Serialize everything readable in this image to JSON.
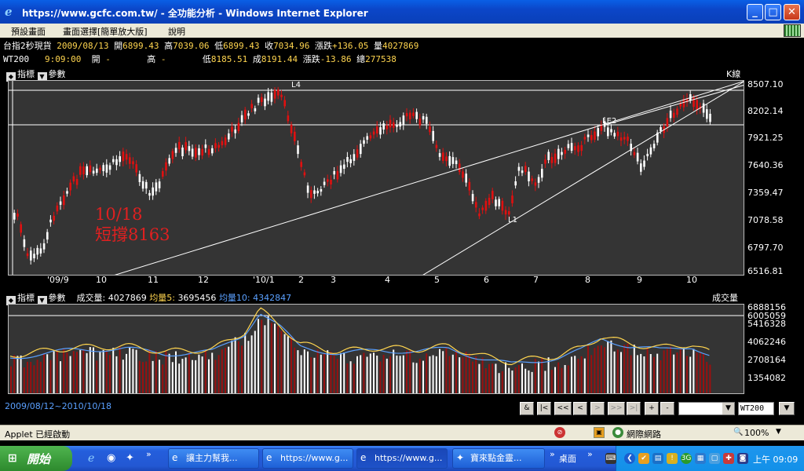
{
  "window": {
    "title": "https://www.gcfc.com.tw/ - 全功能分析 - Windows Internet Explorer",
    "minimize_label": "_",
    "maximize_label": "□",
    "close_label": "✕"
  },
  "menu": {
    "items": [
      "預設畫面",
      "畫面選擇[簡單放大版]",
      "說明"
    ]
  },
  "quotes": {
    "row1": {
      "name": "台指2秒現貨",
      "date": "2009/08/13",
      "open_label": "開",
      "open": "6899.43",
      "high_label": "高",
      "high": "7039.06",
      "low_label": "低",
      "low": "6899.43",
      "close_label": "收",
      "close": "7034.96",
      "change_label": "漲跌",
      "change": "+136.05",
      "volume_label": "量",
      "volume": "4027869"
    },
    "row2": {
      "name": "WT200",
      "time": "9:09:00",
      "open_label": "開",
      "open": "-",
      "high_label": "高",
      "high": "-",
      "low_label": "低",
      "low": "8185.51",
      "close_label": "成",
      "close": "8191.44",
      "change_label": "漲跌",
      "change": "-13.86",
      "total_label": "總",
      "total": "277538"
    }
  },
  "price_panel": {
    "indicator_label": "指標",
    "param_label": "參數",
    "chart_type_label": "K線",
    "annotation_line1": "10/18",
    "annotation_line2": "短撐8163",
    "line_labels": {
      "l4": "L4",
      "le2": "LE2",
      "l1": "L1"
    },
    "y_ticks": [
      "8507.10",
      "8202.14",
      "7921.25",
      "7640.36",
      "7359.47",
      "7078.58",
      "6797.70",
      "6516.81"
    ],
    "x_ticks": [
      "'09/9",
      "10",
      "11",
      "12",
      "'10/1",
      "2",
      "3",
      "4",
      "5",
      "6",
      "7",
      "8",
      "9",
      "10"
    ]
  },
  "volume_panel": {
    "indicator_label": "指標",
    "param_label": "參數",
    "volume_label": "成交量:",
    "volume_value": "4027869",
    "ma5_label": "均量5:",
    "ma5_value": "3695456",
    "ma10_label": "均量10:",
    "ma10_value": "4342847",
    "title": "成交量",
    "y_ticks": [
      "6888156",
      "6005059",
      "5416328",
      "4062246",
      "2708164",
      "1354082"
    ]
  },
  "navbar": {
    "date_range": "2009/08/12~2010/10/18",
    "buttons": [
      "&",
      "|<",
      "<<",
      "<",
      ">",
      ">>",
      ">|",
      "+",
      "-"
    ],
    "symbol_value": "WT200",
    "dropdown_arrow": "▼"
  },
  "statusbar": {
    "text": "Applet 已經啟動",
    "zone": "網際網路",
    "zoom": "100%"
  },
  "taskbar": {
    "start_label": "開始",
    "tasks": [
      "讓主力幫我...",
      "https://www.g...",
      "https://www.g...",
      "寶來點金靈..."
    ],
    "desktop_label": "桌面",
    "clock": "上午 09:09"
  },
  "colors": {
    "candle_up": "#e01010",
    "candle_down": "#ffffff",
    "panel_bg": "#343434",
    "ma5": "#ffd54f",
    "ma10": "#5aa0ff",
    "annotation": "#e02020"
  }
}
